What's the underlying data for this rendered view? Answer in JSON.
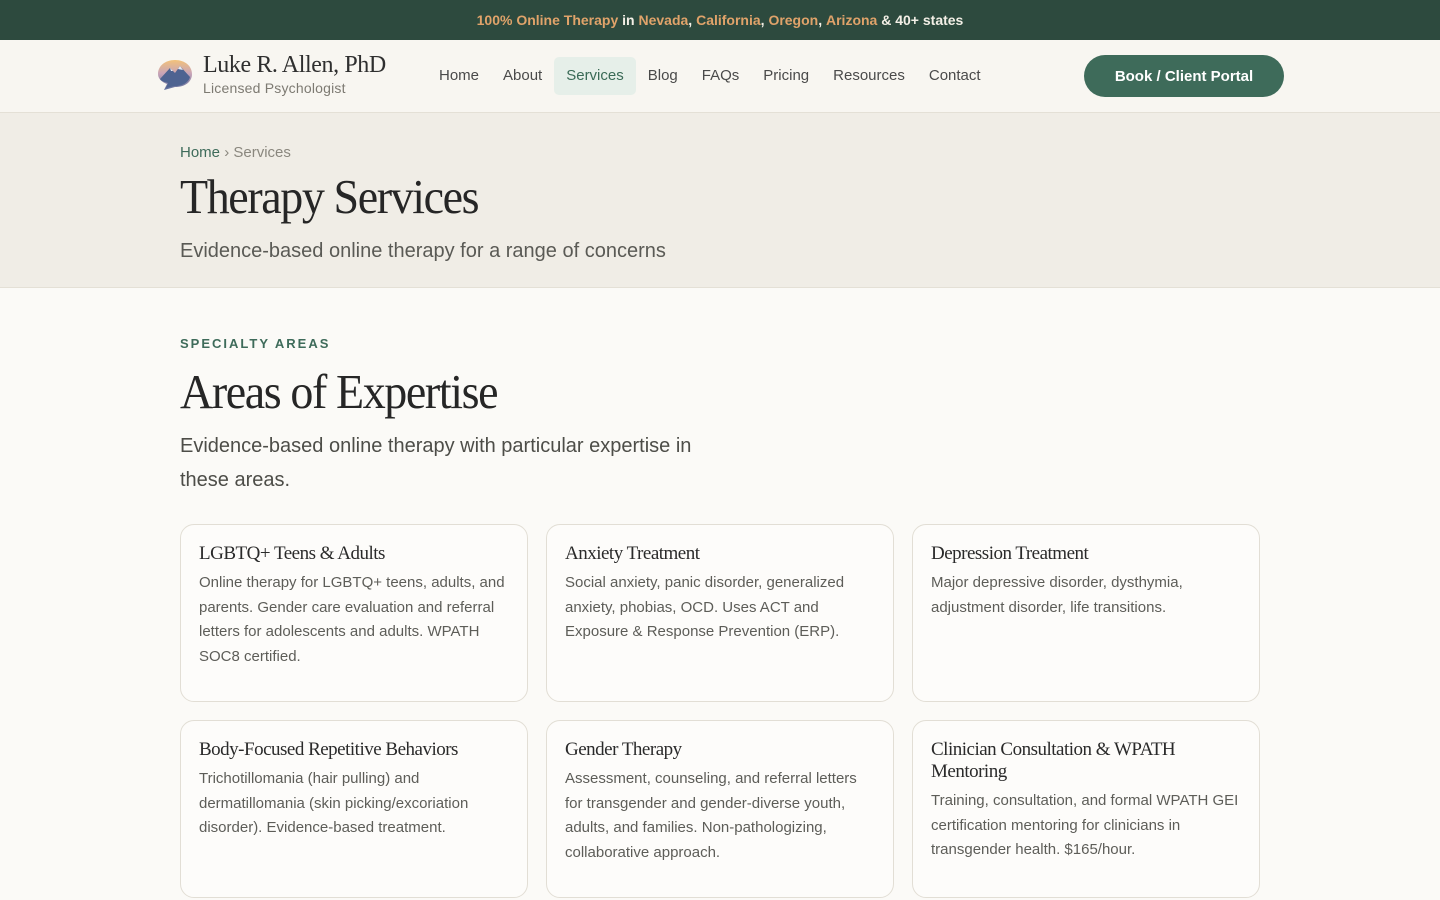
{
  "announcement": {
    "lead": "100% Online Therapy",
    "in": "in",
    "states": [
      "Nevada",
      "California",
      "Oregon",
      "Arizona"
    ],
    "tail": "& 40+ states"
  },
  "brand": {
    "name": "Luke R. Allen, PhD",
    "subtitle": "Licensed Psychologist"
  },
  "nav": {
    "items": [
      "Home",
      "About",
      "Services",
      "Blog",
      "FAQs",
      "Pricing",
      "Resources",
      "Contact"
    ],
    "active": "Services"
  },
  "cta": {
    "label": "Book / Client Portal"
  },
  "hero": {
    "breadcrumb": {
      "home": "Home",
      "separator": "›",
      "current": "Services"
    },
    "title": "Therapy Services",
    "subtitle": "Evidence-based online therapy for a range of concerns"
  },
  "section": {
    "eyebrow": "SPECIALTY AREAS",
    "title": "Areas of Expertise",
    "intro": "Evidence-based online therapy with particular expertise in these areas."
  },
  "cards": [
    {
      "title": "LGBTQ+ Teens & Adults",
      "body": "Online therapy for LGBTQ+ teens, adults, and parents. Gender care evaluation and referral letters for adolescents and adults. WPATH SOC8 certified."
    },
    {
      "title": "Anxiety Treatment",
      "body": "Social anxiety, panic disorder, generalized anxiety, phobias, OCD. Uses ACT and Exposure & Response Prevention (ERP)."
    },
    {
      "title": "Depression Treatment",
      "body": "Major depressive disorder, dysthymia, adjustment disorder, life transitions."
    },
    {
      "title": "Body-Focused Repetitive Behaviors",
      "body": "Trichotillomania (hair pulling) and dermatillomania (skin picking/excoriation disorder). Evidence-based treatment."
    },
    {
      "title": "Gender Therapy",
      "body": "Assessment, counseling, and referral letters for transgender and gender-diverse youth, adults, and families. Non-pathologizing, collaborative approach."
    },
    {
      "title": "Clinician Consultation & WPATH Mentoring",
      "body": "Training, consultation, and formal WPATH GEI certification mentoring for clinicians in transgender health. $165/hour."
    }
  ],
  "colors": {
    "topbar": "#2d4a3e",
    "accent": "#3e6b5a",
    "highlight": "#e0a36a",
    "hero_bg": "#f0ede6"
  },
  "icons": {
    "logo": "mountain-speech-bubble-icon"
  }
}
